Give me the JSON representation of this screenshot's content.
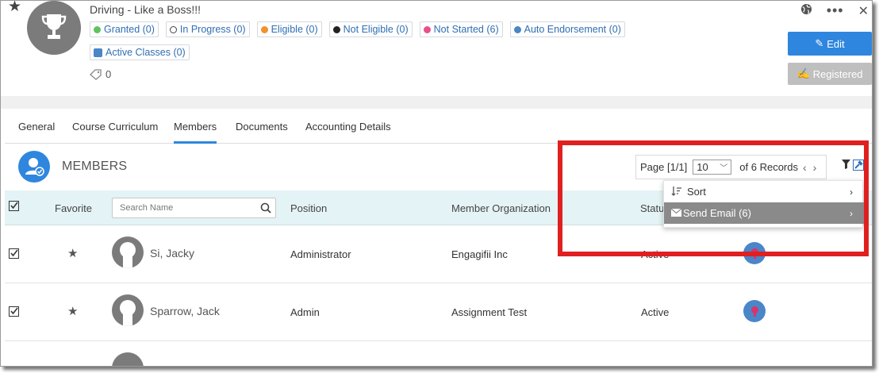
{
  "course": {
    "title": "Driving - Like a Boss!!!",
    "tag_count": "0"
  },
  "badges": [
    {
      "label": "Granted (0)",
      "color": "#5fc45f"
    },
    {
      "label": "In Progress (0)",
      "color": "#ffffff"
    },
    {
      "label": "Eligible (0)",
      "color": "#f0922e"
    },
    {
      "label": "Not Eligible (0)",
      "color": "#222222"
    },
    {
      "label": "Not Started (6)",
      "color": "#e8508a"
    },
    {
      "label": "Auto Endorsement (0)",
      "color": "#4a86c8"
    },
    {
      "label": "Active Classes (0)",
      "color": "#4a86c8"
    }
  ],
  "actions": {
    "edit_label": "Edit",
    "registered_label": "Registered"
  },
  "tabs": [
    {
      "label": "General"
    },
    {
      "label": "Course Curriculum"
    },
    {
      "label": "Members",
      "active": true
    },
    {
      "label": "Documents"
    },
    {
      "label": "Accounting Details"
    }
  ],
  "members": {
    "title": "MEMBERS",
    "pager": {
      "page_label": "Page [1/1]",
      "page_size": "10",
      "records_label": "of 6 Records"
    }
  },
  "table": {
    "headers": {
      "favorite": "Favorite",
      "position": "Position",
      "organization": "Member Organization",
      "status": "Status"
    },
    "search_placeholder": "Search Name",
    "rows": [
      {
        "name": "Si, Jacky",
        "position": "Administrator",
        "organization": "Engagifii Inc",
        "status": "Active"
      },
      {
        "name": "Sparrow, Jack",
        "position": "Admin",
        "organization": "Assignment Test",
        "status": "Active"
      }
    ]
  },
  "dropdown": {
    "sort_label": "Sort",
    "email_label": "Send Email (6)"
  },
  "colors": {
    "accent": "#2f86de",
    "highlight_box": "#e02020",
    "header_row_bg": "#e4f3f5"
  }
}
